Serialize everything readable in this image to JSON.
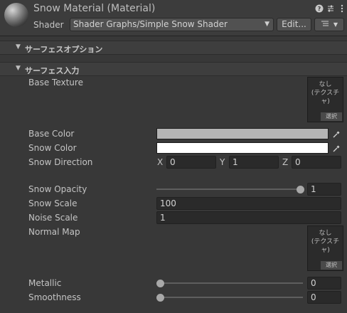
{
  "header": {
    "title": "Snow Material (Material)",
    "shader_label": "Shader",
    "shader_value": "Shader Graphs/Simple Snow Shader",
    "edit_label": "Edit...",
    "icons": [
      "help-icon",
      "preset-icon",
      "more-icon",
      "list-icon"
    ]
  },
  "sections": {
    "surface_options": "サーフェスオプション",
    "surface_inputs": "サーフェス入力"
  },
  "properties": {
    "base_texture": {
      "label": "Base Texture",
      "none": "なし",
      "type": "(テクスチャ)",
      "select": "選択"
    },
    "base_color": {
      "label": "Base Color",
      "color": "#b4b4b4"
    },
    "snow_color": {
      "label": "Snow Color",
      "color": "#ffffff"
    },
    "snow_direction": {
      "label": "Snow Direction",
      "x_label": "X",
      "x": "0",
      "y_label": "Y",
      "y": "1",
      "z_label": "Z",
      "z": "0"
    },
    "snow_opacity": {
      "label": "Snow Opacity",
      "value": "1",
      "fraction": 1.0
    },
    "snow_scale": {
      "label": "Snow Scale",
      "value": "100"
    },
    "noise_scale": {
      "label": "Noise Scale",
      "value": "1"
    },
    "normal_map": {
      "label": "Normal Map",
      "none": "なし",
      "type": "(テクスチャ)",
      "select": "選択"
    },
    "metallic": {
      "label": "Metallic",
      "value": "0",
      "fraction": 0.0
    },
    "smoothness": {
      "label": "Smoothness",
      "value": "0",
      "fraction": 0.0
    }
  }
}
